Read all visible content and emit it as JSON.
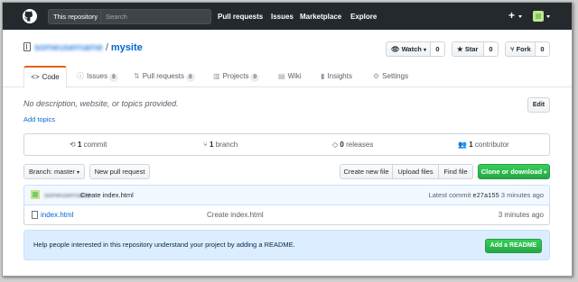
{
  "header": {
    "search_scope": "This repository",
    "search_placeholder": "Search",
    "nav": [
      "Pull requests",
      "Issues",
      "Marketplace",
      "Explore"
    ],
    "plus": "+"
  },
  "repo": {
    "owner": "someusername",
    "separator": "/",
    "name": "mysite",
    "watch_label": "Watch",
    "watch_count": "0",
    "star_label": "Star",
    "star_count": "0",
    "fork_label": "Fork",
    "fork_count": "0"
  },
  "tabs": {
    "code": "Code",
    "issues": "Issues",
    "issues_count": "0",
    "pulls": "Pull requests",
    "pulls_count": "0",
    "projects": "Projects",
    "projects_count": "0",
    "wiki": "Wiki",
    "insights": "Insights",
    "settings": "Settings"
  },
  "about": {
    "description": "No description, website, or topics provided.",
    "edit": "Edit",
    "add_topics": "Add topics"
  },
  "summary": {
    "commits_num": "1",
    "commits_label": "commit",
    "branches_num": "1",
    "branches_label": "branch",
    "releases_num": "0",
    "releases_label": "releases",
    "contributors_num": "1",
    "contributors_label": "contributor"
  },
  "filenav": {
    "branch": "Branch: master",
    "new_pr": "New pull request",
    "create_file": "Create new file",
    "upload": "Upload files",
    "find": "Find file",
    "clone": "Clone or download"
  },
  "commit": {
    "author": "someusername",
    "message": "Create index.html",
    "latest_label": "Latest commit",
    "sha": "e27a155",
    "age": "3 minutes ago"
  },
  "files": [
    {
      "name": "index.html",
      "message": "Create index.html",
      "age": "3 minutes ago"
    }
  ],
  "readme": {
    "text": "Help people interested in this repository understand your project by adding a README.",
    "button": "Add a README"
  },
  "colors": {
    "header_bg": "#24292e",
    "link": "#0366d6",
    "green": "#28a745",
    "tab_accent": "#e36209"
  }
}
